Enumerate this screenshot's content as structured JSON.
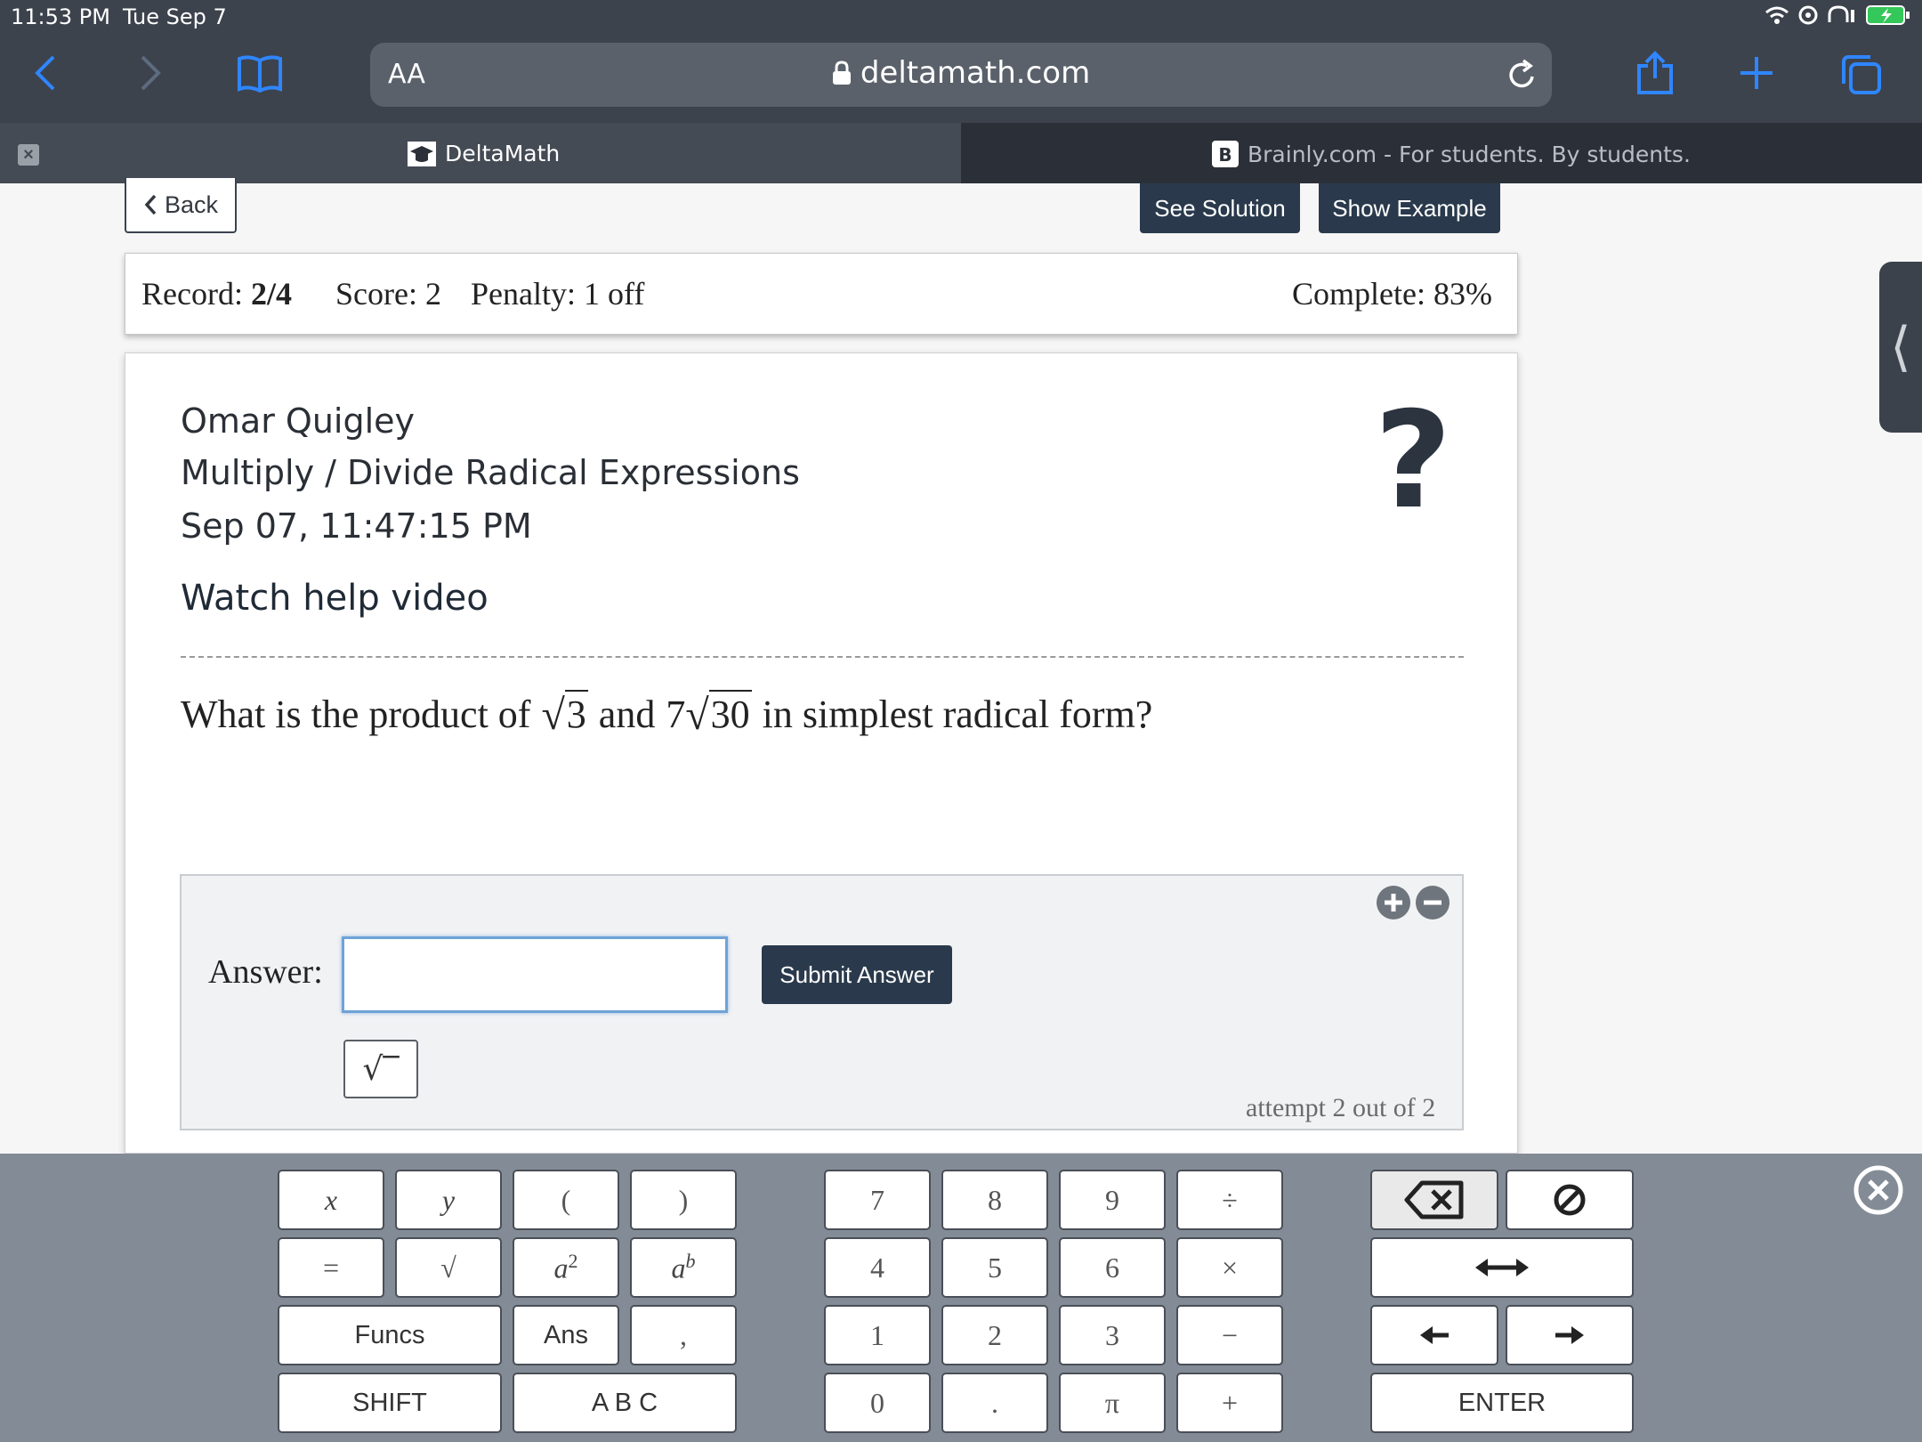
{
  "status_bar": {
    "time": "11:53 PM",
    "date": "Tue Sep 7"
  },
  "browser": {
    "text_size_label": "AA",
    "domain": "deltamath.com",
    "tabs": [
      {
        "title": "DeltaMath",
        "active": true
      },
      {
        "title": "Brainly.com - For students. By students.",
        "active": false
      }
    ]
  },
  "toolbar": {
    "back_label": "Back",
    "see_solution_label": "See Solution",
    "show_example_label": "Show Example"
  },
  "record_bar": {
    "record_label": "Record:",
    "record_value": "2/4",
    "score": "Score: 2",
    "penalty": "Penalty: 1 off",
    "complete": "Complete: 83%"
  },
  "assignment": {
    "student_name": "Omar Quigley",
    "topic": "Multiply / Divide Radical Expressions",
    "timestamp": "Sep 07, 11:47:15 PM",
    "help_link": "Watch help video",
    "help_icon": "?"
  },
  "question": {
    "prefix": "What is the product of",
    "radical1": "3",
    "conj": "and",
    "coef2": "7",
    "radical2": "30",
    "suffix": "in simplest radical form?"
  },
  "answer": {
    "label": "Answer:",
    "value": "",
    "submit_label": "Submit Answer",
    "attempt_text": "attempt 2 out of 2"
  },
  "keyboard": {
    "variables": [
      "x",
      "y",
      "(",
      ")"
    ],
    "equals": "=",
    "sqrt": "√",
    "funcs": "Funcs",
    "ans": "Ans",
    "comma": ",",
    "shift": "SHIFT",
    "abc": "A B C",
    "digits_row1": [
      "7",
      "8",
      "9",
      "÷"
    ],
    "digits_row2": [
      "4",
      "5",
      "6",
      "×"
    ],
    "digits_row3": [
      "1",
      "2",
      "3",
      "−"
    ],
    "digits_row4": [
      "0",
      ".",
      "π",
      "+"
    ],
    "enter": "ENTER"
  },
  "colors": {
    "chrome_bg": "#3d434d",
    "accent_blue": "#2f86ff",
    "button_dark": "#2a3a4c",
    "keyboard_bg": "#838c96"
  }
}
